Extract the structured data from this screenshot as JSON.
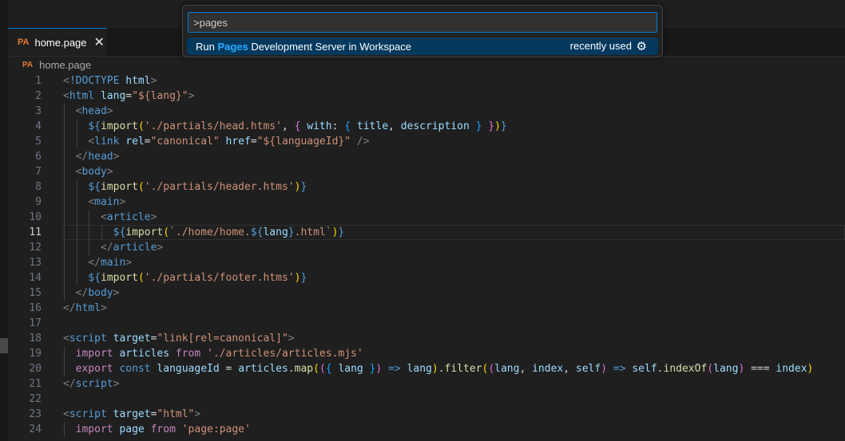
{
  "tab": {
    "icon_text": "PA",
    "label": "home.page",
    "close_icon": "close-icon"
  },
  "breadcrumb": {
    "icon_text": "PA",
    "label": "home.page"
  },
  "command_palette": {
    "input_value": ">pages",
    "result": {
      "prefix": "Run ",
      "highlight": "Pages",
      "suffix": " Development Server in Workspace",
      "hint": "recently used",
      "icon": "gear-icon"
    }
  },
  "editor": {
    "current_line": 11,
    "lines": [
      {
        "n": "1",
        "tokens": [
          [
            "t-punct",
            "<"
          ],
          [
            "t-tag",
            "!DOCTYPE"
          ],
          [
            "t-plain",
            " "
          ],
          [
            "t-attr",
            "html"
          ],
          [
            "t-punct",
            ">"
          ]
        ]
      },
      {
        "n": "2",
        "tokens": [
          [
            "t-punct",
            "<"
          ],
          [
            "t-tag",
            "html"
          ],
          [
            "t-plain",
            " "
          ],
          [
            "t-attr",
            "lang"
          ],
          [
            "t-plain",
            "="
          ],
          [
            "t-str",
            "\"${lang}\""
          ],
          [
            "t-punct",
            ">"
          ]
        ]
      },
      {
        "n": "3",
        "tokens": [
          [
            "t-plain",
            "  "
          ],
          [
            "t-punct",
            "<"
          ],
          [
            "t-tag",
            "head"
          ],
          [
            "t-punct",
            ">"
          ]
        ]
      },
      {
        "n": "4",
        "tokens": [
          [
            "t-plain",
            "    "
          ],
          [
            "t-tag",
            "${"
          ],
          [
            "t-fn",
            "import"
          ],
          [
            "t-brace3",
            "("
          ],
          [
            "t-str",
            "'./partials/head.htms'"
          ],
          [
            "t-plain",
            ", "
          ],
          [
            "t-brace",
            "{"
          ],
          [
            "t-plain",
            " "
          ],
          [
            "t-attr",
            "with"
          ],
          [
            "t-plain",
            ": "
          ],
          [
            "t-brace2",
            "{"
          ],
          [
            "t-plain",
            " "
          ],
          [
            "t-var",
            "title"
          ],
          [
            "t-plain",
            ", "
          ],
          [
            "t-var",
            "description"
          ],
          [
            "t-plain",
            " "
          ],
          [
            "t-brace2",
            "}"
          ],
          [
            "t-plain",
            " "
          ],
          [
            "t-brace",
            "}"
          ],
          [
            "t-brace3",
            ")"
          ],
          [
            "t-tag",
            "}"
          ]
        ]
      },
      {
        "n": "5",
        "tokens": [
          [
            "t-plain",
            "    "
          ],
          [
            "t-punct",
            "<"
          ],
          [
            "t-tag",
            "link"
          ],
          [
            "t-plain",
            " "
          ],
          [
            "t-attr",
            "rel"
          ],
          [
            "t-plain",
            "="
          ],
          [
            "t-str",
            "\"canonical\""
          ],
          [
            "t-plain",
            " "
          ],
          [
            "t-attr",
            "href"
          ],
          [
            "t-plain",
            "="
          ],
          [
            "t-str",
            "\"${languageId}\""
          ],
          [
            "t-plain",
            " "
          ],
          [
            "t-punct",
            "/>"
          ]
        ]
      },
      {
        "n": "6",
        "tokens": [
          [
            "t-plain",
            "  "
          ],
          [
            "t-punct",
            "</"
          ],
          [
            "t-tag",
            "head"
          ],
          [
            "t-punct",
            ">"
          ]
        ]
      },
      {
        "n": "7",
        "tokens": [
          [
            "t-plain",
            "  "
          ],
          [
            "t-punct",
            "<"
          ],
          [
            "t-tag",
            "body"
          ],
          [
            "t-punct",
            ">"
          ]
        ]
      },
      {
        "n": "8",
        "tokens": [
          [
            "t-plain",
            "    "
          ],
          [
            "t-tag",
            "${"
          ],
          [
            "t-fn",
            "import"
          ],
          [
            "t-brace3",
            "("
          ],
          [
            "t-str",
            "'./partials/header.htms'"
          ],
          [
            "t-brace3",
            ")"
          ],
          [
            "t-tag",
            "}"
          ]
        ]
      },
      {
        "n": "9",
        "tokens": [
          [
            "t-plain",
            "    "
          ],
          [
            "t-punct",
            "<"
          ],
          [
            "t-tag",
            "main"
          ],
          [
            "t-punct",
            ">"
          ]
        ]
      },
      {
        "n": "10",
        "tokens": [
          [
            "t-plain",
            "      "
          ],
          [
            "t-punct",
            "<"
          ],
          [
            "t-tag",
            "article"
          ],
          [
            "t-punct",
            ">"
          ]
        ]
      },
      {
        "n": "11",
        "tokens": [
          [
            "t-plain",
            "        "
          ],
          [
            "t-tag",
            "${"
          ],
          [
            "t-fn",
            "import"
          ],
          [
            "t-brace3",
            "("
          ],
          [
            "t-str",
            "`./home/home."
          ],
          [
            "t-tag",
            "${"
          ],
          [
            "t-var",
            "lang"
          ],
          [
            "t-tag",
            "}"
          ],
          [
            "t-str",
            ".html`"
          ],
          [
            "t-brace3",
            ")"
          ],
          [
            "t-tag",
            "}"
          ]
        ]
      },
      {
        "n": "12",
        "tokens": [
          [
            "t-plain",
            "      "
          ],
          [
            "t-punct",
            "</"
          ],
          [
            "t-tag",
            "article"
          ],
          [
            "t-punct",
            ">"
          ]
        ]
      },
      {
        "n": "13",
        "tokens": [
          [
            "t-plain",
            "    "
          ],
          [
            "t-punct",
            "</"
          ],
          [
            "t-tag",
            "main"
          ],
          [
            "t-punct",
            ">"
          ]
        ]
      },
      {
        "n": "14",
        "tokens": [
          [
            "t-plain",
            "    "
          ],
          [
            "t-tag",
            "${"
          ],
          [
            "t-fn",
            "import"
          ],
          [
            "t-brace3",
            "("
          ],
          [
            "t-str",
            "'./partials/footer.htms'"
          ],
          [
            "t-brace3",
            ")"
          ],
          [
            "t-tag",
            "}"
          ]
        ]
      },
      {
        "n": "15",
        "tokens": [
          [
            "t-plain",
            "  "
          ],
          [
            "t-punct",
            "</"
          ],
          [
            "t-tag",
            "body"
          ],
          [
            "t-punct",
            ">"
          ]
        ]
      },
      {
        "n": "16",
        "tokens": [
          [
            "t-punct",
            "</"
          ],
          [
            "t-tag",
            "html"
          ],
          [
            "t-punct",
            ">"
          ]
        ]
      },
      {
        "n": "17",
        "tokens": []
      },
      {
        "n": "18",
        "tokens": [
          [
            "t-punct",
            "<"
          ],
          [
            "t-tag",
            "script"
          ],
          [
            "t-plain",
            " "
          ],
          [
            "t-attr",
            "target"
          ],
          [
            "t-plain",
            "="
          ],
          [
            "t-str",
            "\"link[rel=canonical]\""
          ],
          [
            "t-punct",
            ">"
          ]
        ]
      },
      {
        "n": "19",
        "tokens": [
          [
            "t-plain",
            "  "
          ],
          [
            "t-kw",
            "import"
          ],
          [
            "t-plain",
            " "
          ],
          [
            "t-var",
            "articles"
          ],
          [
            "t-plain",
            " "
          ],
          [
            "t-kw",
            "from"
          ],
          [
            "t-plain",
            " "
          ],
          [
            "t-str",
            "'./articles/articles.mjs'"
          ]
        ]
      },
      {
        "n": "20",
        "tokens": [
          [
            "t-plain",
            "  "
          ],
          [
            "t-kw",
            "export"
          ],
          [
            "t-plain",
            " "
          ],
          [
            "t-tag",
            "const"
          ],
          [
            "t-plain",
            " "
          ],
          [
            "t-var",
            "languageId"
          ],
          [
            "t-plain",
            " = "
          ],
          [
            "t-var",
            "articles"
          ],
          [
            "t-plain",
            "."
          ],
          [
            "t-fn",
            "map"
          ],
          [
            "t-brace3",
            "("
          ],
          [
            "t-brace",
            "("
          ],
          [
            "t-brace2",
            "{"
          ],
          [
            "t-plain",
            " "
          ],
          [
            "t-var",
            "lang"
          ],
          [
            "t-plain",
            " "
          ],
          [
            "t-brace2",
            "}"
          ],
          [
            "t-brace",
            ")"
          ],
          [
            "t-plain",
            " "
          ],
          [
            "t-tag",
            "=>"
          ],
          [
            "t-plain",
            " "
          ],
          [
            "t-var",
            "lang"
          ],
          [
            "t-brace3",
            ")"
          ],
          [
            "t-plain",
            "."
          ],
          [
            "t-fn",
            "filter"
          ],
          [
            "t-brace3",
            "("
          ],
          [
            "t-brace",
            "("
          ],
          [
            "t-var",
            "lang"
          ],
          [
            "t-plain",
            ", "
          ],
          [
            "t-var",
            "index"
          ],
          [
            "t-plain",
            ", "
          ],
          [
            "t-var",
            "self"
          ],
          [
            "t-brace",
            ")"
          ],
          [
            "t-plain",
            " "
          ],
          [
            "t-tag",
            "=>"
          ],
          [
            "t-plain",
            " "
          ],
          [
            "t-var",
            "self"
          ],
          [
            "t-plain",
            "."
          ],
          [
            "t-fn",
            "indexOf"
          ],
          [
            "t-brace",
            "("
          ],
          [
            "t-var",
            "lang"
          ],
          [
            "t-brace",
            ")"
          ],
          [
            "t-plain",
            " === "
          ],
          [
            "t-var",
            "index"
          ],
          [
            "t-brace3",
            ")"
          ]
        ]
      },
      {
        "n": "21",
        "tokens": [
          [
            "t-punct",
            "</"
          ],
          [
            "t-tag",
            "script"
          ],
          [
            "t-punct",
            ">"
          ]
        ]
      },
      {
        "n": "22",
        "tokens": []
      },
      {
        "n": "23",
        "tokens": [
          [
            "t-punct",
            "<"
          ],
          [
            "t-tag",
            "script"
          ],
          [
            "t-plain",
            " "
          ],
          [
            "t-attr",
            "target"
          ],
          [
            "t-plain",
            "="
          ],
          [
            "t-str",
            "\"html\""
          ],
          [
            "t-punct",
            ">"
          ]
        ]
      },
      {
        "n": "24",
        "tokens": [
          [
            "t-plain",
            "  "
          ],
          [
            "t-kw",
            "import"
          ],
          [
            "t-plain",
            " "
          ],
          [
            "t-var",
            "page"
          ],
          [
            "t-plain",
            " "
          ],
          [
            "t-kw",
            "from"
          ],
          [
            "t-plain",
            " "
          ],
          [
            "t-str",
            "'page:page'"
          ]
        ]
      }
    ]
  }
}
